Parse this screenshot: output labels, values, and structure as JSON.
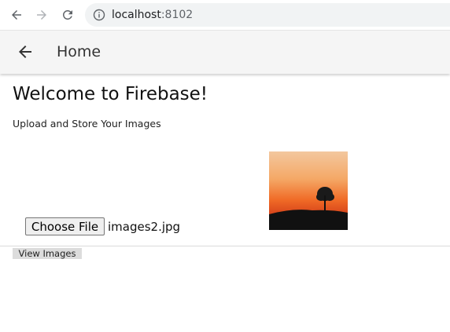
{
  "browser": {
    "url_host": "localhost",
    "url_port": ":8102"
  },
  "app_bar": {
    "title": "Home"
  },
  "main": {
    "title": "Welcome to Firebase!",
    "subtitle": "Upload and Store Your Images",
    "choose_file_label": "Choose File",
    "file_name": "images2.jpg",
    "view_images_label": "View Images"
  },
  "icons": {
    "back": "back-arrow-icon",
    "forward": "forward-arrow-icon",
    "reload": "reload-icon",
    "info": "info-icon"
  },
  "colors": {
    "app_bar_bg": "#f5f5f5",
    "omnibox_bg": "#f1f3f4"
  }
}
